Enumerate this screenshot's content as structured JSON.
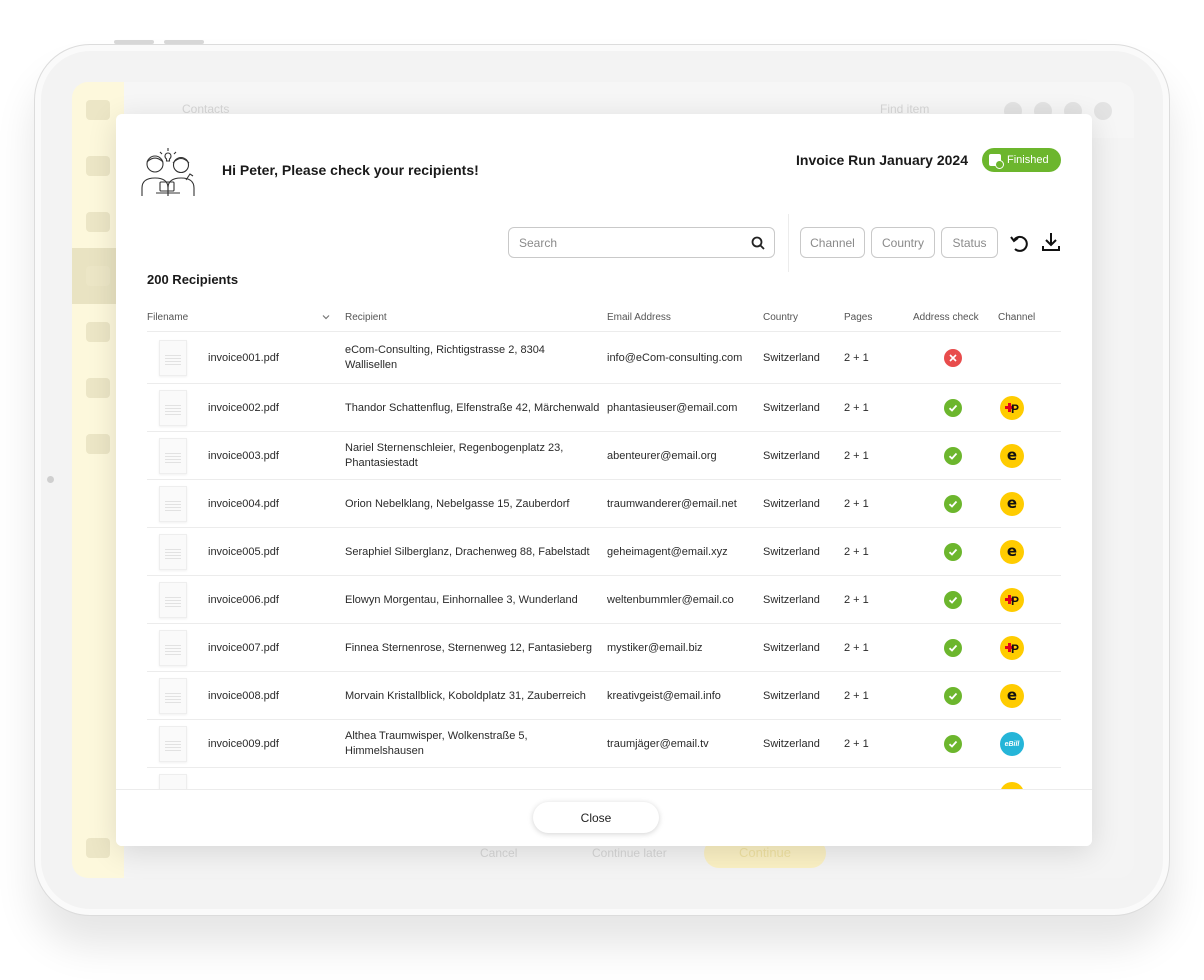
{
  "background": {
    "breadcrumb": "Contacts",
    "header_search": "Find item",
    "footer_buttons": {
      "cancel": "Cancel",
      "continue_later": "Continue later",
      "continue": "Continue"
    }
  },
  "modal": {
    "greeting": "Hi Peter, Please check your recipients!",
    "run_title": "Invoice Run January 2024",
    "status_badge": "Finished",
    "search_placeholder": "Search",
    "filters": {
      "channel": "Channel",
      "country": "Country",
      "status": "Status"
    },
    "recipient_count": "200 Recipients",
    "columns": {
      "filename": "Filename",
      "recipient": "Recipient",
      "email": "Email Address",
      "country": "Country",
      "pages": "Pages",
      "address_check": "Address check",
      "channel": "Channel"
    },
    "rows": [
      {
        "filename": "invoice001.pdf",
        "recipient": "eCom-Consulting, Richtigstrasse 2, 8304 Wallisellen",
        "email": "info@eCom-consulting.com",
        "country": "Switzerland",
        "pages": "2 + 1",
        "address_check": "error",
        "channel": "none"
      },
      {
        "filename": "invoice002.pdf",
        "recipient": "Thandor Schattenflug, Elfenstraße 42, Märchenwald",
        "email": "phantasieuser@email.com",
        "country": "Switzerland",
        "pages": "2 + 1",
        "address_check": "ok",
        "channel": "post"
      },
      {
        "filename": "invoice003.pdf",
        "recipient": "Nariel Sternenschleier, Regenbogenplatz 23, Phantasiestadt",
        "email": "abenteurer@email.org",
        "country": "Switzerland",
        "pages": "2 + 1",
        "address_check": "ok",
        "channel": "e"
      },
      {
        "filename": "invoice004.pdf",
        "recipient": "Orion Nebelklang, Nebelgasse 15, Zauberdorf",
        "email": "traumwanderer@email.net",
        "country": "Switzerland",
        "pages": "2 + 1",
        "address_check": "ok",
        "channel": "e"
      },
      {
        "filename": "invoice005.pdf",
        "recipient": "Seraphiel Silberglanz, Drachenweg 88, Fabelstadt",
        "email": "geheimagent@email.xyz",
        "country": "Switzerland",
        "pages": "2 + 1",
        "address_check": "ok",
        "channel": "e"
      },
      {
        "filename": "invoice006.pdf",
        "recipient": "Elowyn Morgentau, Einhornallee 3, Wunderland",
        "email": "weltenbummler@email.co",
        "country": "Switzerland",
        "pages": "2 + 1",
        "address_check": "ok",
        "channel": "post"
      },
      {
        "filename": "invoice007.pdf",
        "recipient": "Finnea Sternenrose, Sternenweg 12, Fantasieberg",
        "email": "mystiker@email.biz",
        "country": "Switzerland",
        "pages": "2 + 1",
        "address_check": "ok",
        "channel": "post"
      },
      {
        "filename": "invoice008.pdf",
        "recipient": "Morvain Kristallblick, Koboldplatz 31, Zauberreich",
        "email": "kreativgeist@email.info",
        "country": "Switzerland",
        "pages": "2 + 1",
        "address_check": "ok",
        "channel": "e"
      },
      {
        "filename": "invoice009.pdf",
        "recipient": "Althea Traumwisper, Wolkenstraße 5, Himmelshausen",
        "email": "traumjäger@email.tv",
        "country": "Switzerland",
        "pages": "2 + 1",
        "address_check": "ok",
        "channel": "ebill"
      }
    ],
    "channel_labels": {
      "post": "P",
      "e": "e",
      "ebill": "eBill"
    },
    "close_button": "Close"
  },
  "colors": {
    "success": "#6cb62d",
    "error": "#e84c4c",
    "post_yellow": "#ffcc00",
    "ebill_blue": "#25b5d8"
  }
}
